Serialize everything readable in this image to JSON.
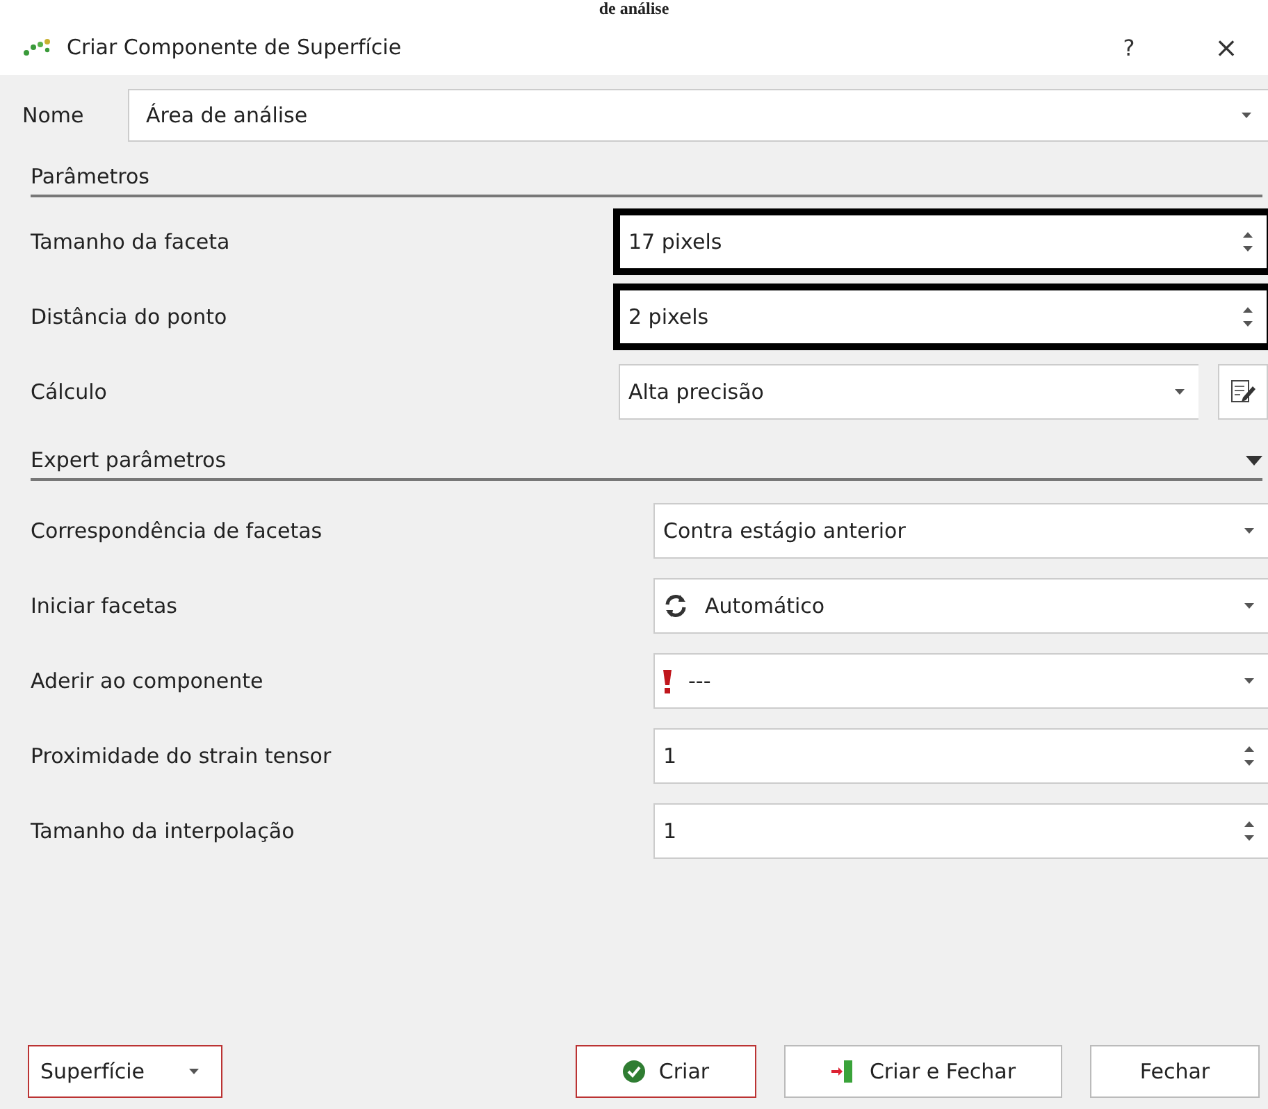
{
  "caption": "de análise",
  "window": {
    "title": "Criar Componente de Superfície",
    "help": "?",
    "close": "×"
  },
  "name_field": {
    "label": "Nome",
    "value": "Área de análise"
  },
  "sections": [
    {
      "title": "Parâmetros",
      "collapsible": false,
      "rows": [
        {
          "kind": "spin",
          "label": "Tamanho da faceta",
          "value": "17 pixels",
          "highlighted": true
        },
        {
          "kind": "spin",
          "label": "Distância do ponto",
          "value": "2 pixels",
          "highlighted": true
        },
        {
          "kind": "combo-edit",
          "label": "Cálculo",
          "value": "Alta precisão",
          "highlighted": false
        }
      ]
    },
    {
      "title": "Expert parâmetros",
      "collapsible": true,
      "rows": [
        {
          "kind": "combo",
          "label": "Correspondência de facetas",
          "value": "Contra estágio anterior",
          "highlighted": false
        },
        {
          "kind": "combo-refresh",
          "label": "Iniciar facetas",
          "value": "Automático",
          "highlighted": false
        },
        {
          "kind": "combo-warning",
          "label": "Aderir ao componente",
          "value": "---",
          "highlighted": false
        },
        {
          "kind": "spin",
          "label": "Proximidade do strain tensor",
          "value": "1",
          "highlighted": false
        },
        {
          "kind": "spin",
          "label": "Tamanho da interpolação",
          "value": "1",
          "highlighted": false
        }
      ]
    }
  ],
  "footer": {
    "type_select": "Superfície",
    "buttons": [
      {
        "kind": "create",
        "label": "Criar",
        "focused": true
      },
      {
        "kind": "create-close",
        "label": "Criar e Fechar",
        "focused": false
      },
      {
        "kind": "close",
        "label": "Fechar",
        "focused": false
      }
    ]
  }
}
